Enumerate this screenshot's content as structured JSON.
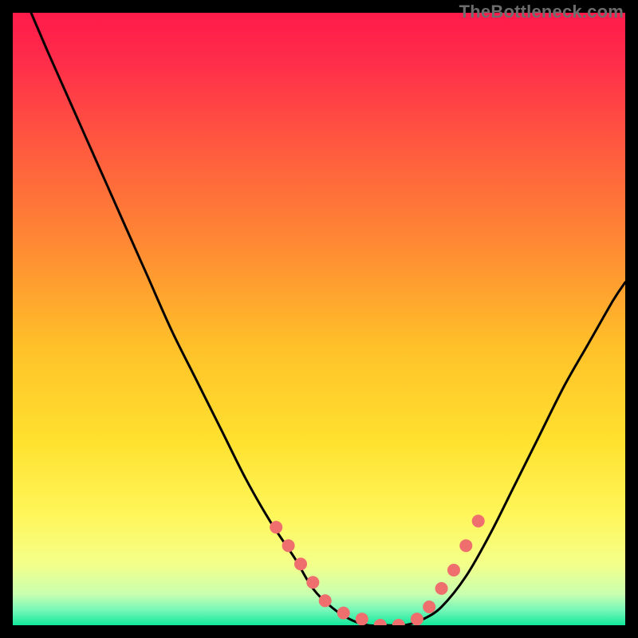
{
  "watermark": "TheBottleneck.com",
  "colors": {
    "frame": "#000000",
    "curve_stroke": "#000000",
    "dot_fill": "#ef6e6e",
    "gradient_stops": [
      {
        "offset": 0.0,
        "color": "#ff1a4a"
      },
      {
        "offset": 0.08,
        "color": "#ff2d4a"
      },
      {
        "offset": 0.22,
        "color": "#ff5a3f"
      },
      {
        "offset": 0.38,
        "color": "#ff8a33"
      },
      {
        "offset": 0.55,
        "color": "#ffc229"
      },
      {
        "offset": 0.7,
        "color": "#ffe12f"
      },
      {
        "offset": 0.82,
        "color": "#fff65a"
      },
      {
        "offset": 0.9,
        "color": "#f4ff8a"
      },
      {
        "offset": 0.95,
        "color": "#c7ffb0"
      },
      {
        "offset": 0.975,
        "color": "#77f7b8"
      },
      {
        "offset": 1.0,
        "color": "#12e89a"
      }
    ]
  },
  "chart_data": {
    "type": "line",
    "title": "",
    "xlabel": "",
    "ylabel": "",
    "xlim": [
      0,
      100
    ],
    "ylim": [
      0,
      100
    ],
    "grid": false,
    "legend": false,
    "series": [
      {
        "name": "bottleneck-curve",
        "x": [
          3,
          6,
          10,
          14,
          18,
          22,
          26,
          30,
          34,
          38,
          42,
          46,
          49,
          52,
          55,
          58,
          61,
          64,
          67,
          70,
          74,
          78,
          82,
          86,
          90,
          94,
          98,
          100
        ],
        "y": [
          100,
          93,
          84,
          75,
          66,
          57,
          48,
          40,
          32,
          24,
          17,
          11,
          6,
          3,
          1,
          0,
          0,
          0,
          1,
          3,
          8,
          15,
          23,
          31,
          39,
          46,
          53,
          56
        ]
      }
    ],
    "highlight_points": {
      "name": "target-range-dots",
      "x": [
        43,
        45,
        47,
        49,
        51,
        54,
        57,
        60,
        63,
        66,
        68,
        70,
        72,
        74,
        76
      ],
      "y": [
        16,
        13,
        10,
        7,
        4,
        2,
        1,
        0,
        0,
        1,
        3,
        6,
        9,
        13,
        17
      ]
    }
  }
}
